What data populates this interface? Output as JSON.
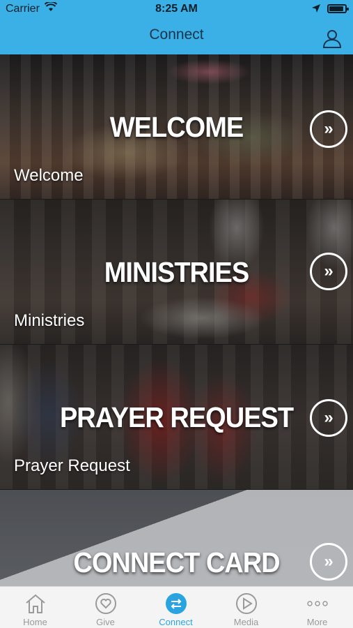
{
  "status_bar": {
    "carrier": "Carrier",
    "time": "8:25 AM",
    "battery_level": 0.92
  },
  "header": {
    "title": "Connect",
    "profile_icon": "person-icon"
  },
  "cards": [
    {
      "title": "WELCOME",
      "label": "Welcome",
      "icon": "double-chevron-right-icon"
    },
    {
      "title": "MINISTRIES",
      "label": "Ministries",
      "icon": "double-chevron-right-icon"
    },
    {
      "title": "PRAYER REQUEST",
      "label": "Prayer Request",
      "icon": "double-chevron-right-icon"
    },
    {
      "title": "CONNECT CARD",
      "label": "",
      "icon": "double-chevron-right-icon"
    }
  ],
  "tabbar": {
    "active": "Connect",
    "accent": "#2aa4e0",
    "items": [
      {
        "label": "Home",
        "icon": "house-icon"
      },
      {
        "label": "Give",
        "icon": "heart-icon"
      },
      {
        "label": "Connect",
        "icon": "exchange-arrows-icon"
      },
      {
        "label": "Media",
        "icon": "play-icon"
      },
      {
        "label": "More",
        "icon": "ellipsis-icon"
      }
    ]
  },
  "colors": {
    "header": "#3ab0e6",
    "tab_active": "#2aa4e0",
    "tab_inactive": "#9a9a9a"
  }
}
